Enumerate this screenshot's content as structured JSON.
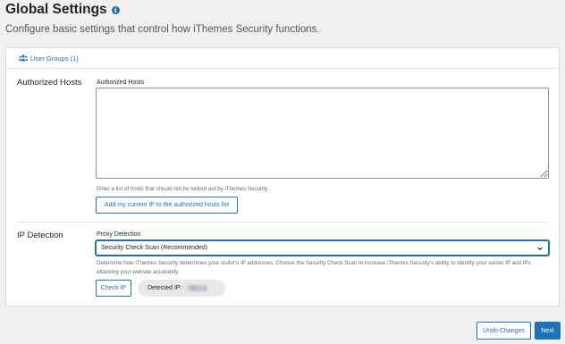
{
  "header": {
    "title": "Global Settings",
    "info_icon": "info-icon",
    "subtitle": "Configure basic settings that control how iThemes Security functions."
  },
  "tabs": [
    {
      "label": "User Groups (1)",
      "icon": "users-icon"
    }
  ],
  "authorized_hosts": {
    "section_label": "Authorized Hosts",
    "field_label": "Authorized Hosts",
    "value": "",
    "help": "Enter a list of hosts that should not be locked out by iThemes Security.",
    "add_button_label": "Add my current IP to the authorized hosts list"
  },
  "ip_detection": {
    "section_label": "IP Detection",
    "field_label": "Proxy Detection",
    "selected_option": "Security Check Scan (Recommended)",
    "help": "Determine how iThemes Security determines your visitor's IP addresses. Choose the Security Check Scan to increase iThemes Security's ability to identify your server IP and IPs attacking your website accurately.",
    "check_ip_label": "Check IP",
    "detected_ip_label": "Detected IP:"
  },
  "footer": {
    "undo_label": "Undo Changes",
    "next_label": "Next"
  },
  "colors": {
    "accent": "#2271b1",
    "background": "#f0f0f1",
    "card": "#ffffff"
  }
}
